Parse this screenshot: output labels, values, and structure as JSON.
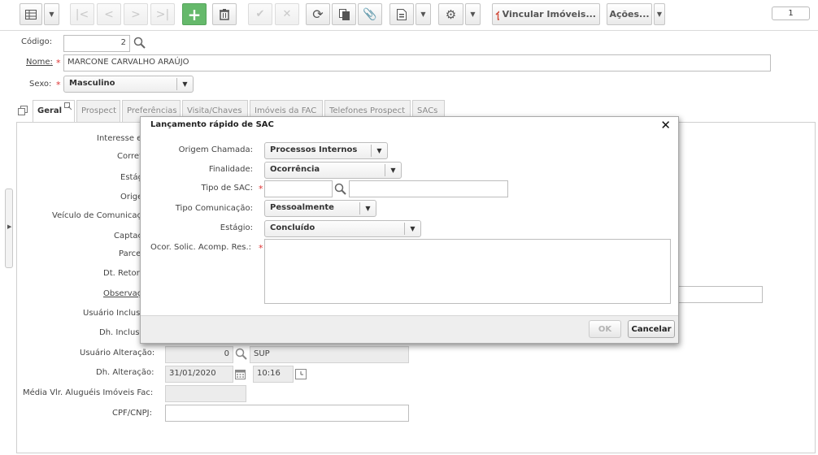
{
  "toolbar": {
    "actions_label": "Ações...",
    "link_label": "Vincular Imóveis...",
    "page_number": "1"
  },
  "form": {
    "codigo": {
      "label": "Código:",
      "value": "2"
    },
    "nome": {
      "label": "Nome:",
      "value": "MARCONE CARVALHO ARAÚJO"
    },
    "sexo": {
      "label": "Sexo:",
      "value": "Masculino"
    }
  },
  "tabs": [
    "Geral",
    "Prospect",
    "Preferências",
    "Visita/Chaves",
    "Imóveis da FAC",
    "Telefones Prospect",
    "SACs"
  ],
  "geral": {
    "labels_partial": [
      "Interesse e",
      "Corret",
      "Estág",
      "Orige",
      "Veículo de Comunicaç",
      "Captaç",
      "Parce",
      "Dt. Retor",
      "Observaç",
      "Usuário Inclus",
      "Dh. Inclus"
    ],
    "usuario_alteracao": {
      "label": "Usuário Alteração:",
      "code": "0",
      "name": "SUP"
    },
    "dh_alteracao": {
      "label": "Dh. Alteração:",
      "date": "31/01/2020",
      "time": "10:16"
    },
    "media_label": "Média Vlr. Aluguéis Imóveis Fac:",
    "cpf_label": "CPF/CNPJ:"
  },
  "modal": {
    "title": "Lançamento rápido de SAC",
    "origem": {
      "label": "Origem Chamada:",
      "value": "Processos Internos"
    },
    "finalidade": {
      "label": "Finalidade:",
      "value": "Ocorrência"
    },
    "tipo_sac": {
      "label": "Tipo de SAC:"
    },
    "tipo_comunicacao": {
      "label": "Tipo Comunicação:",
      "value": "Pessoalmente"
    },
    "estagio": {
      "label": "Estágio:",
      "value": "Concluído"
    },
    "ocor": {
      "label": "Ocor. Solic. Acomp. Res.:"
    },
    "ok_label": "OK",
    "cancel_label": "Cancelar"
  },
  "colors": {
    "add_button": "#65b96b",
    "required": "#d33333",
    "home_icon": "#d04a3a"
  }
}
